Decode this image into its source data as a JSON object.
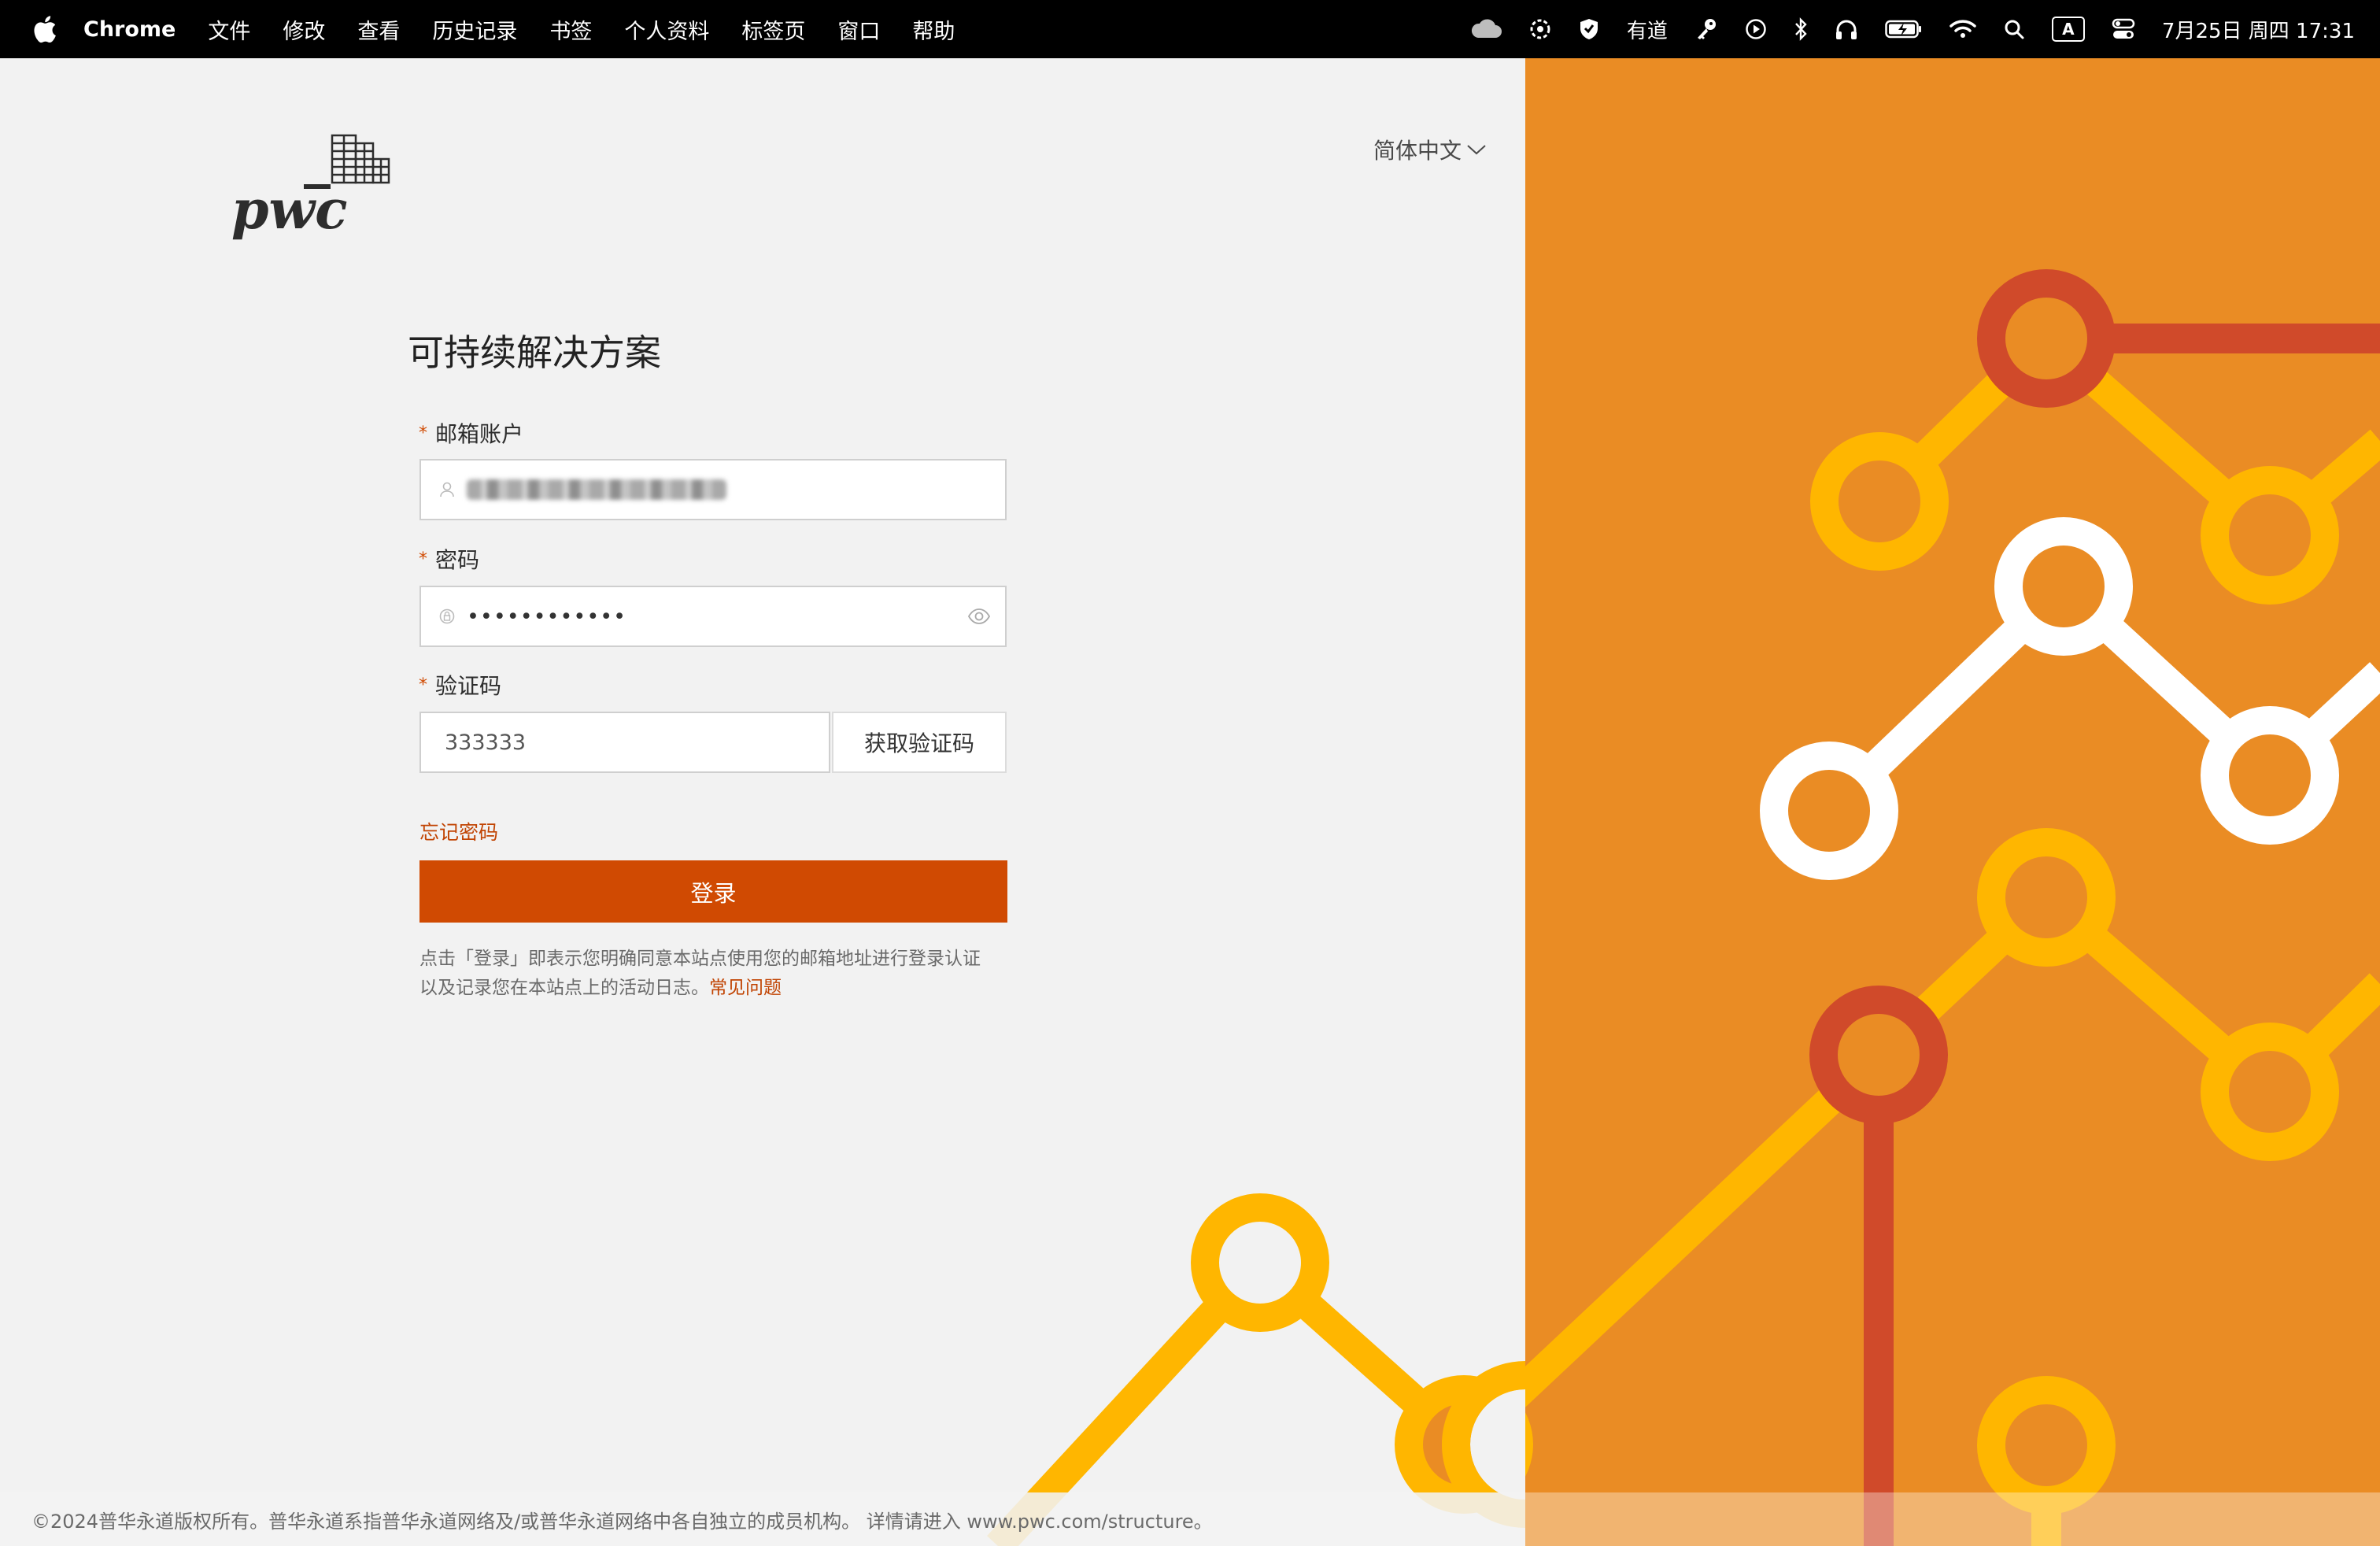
{
  "menubar": {
    "app_name": "Chrome",
    "items": [
      "文件",
      "修改",
      "查看",
      "历史记录",
      "书签",
      "个人资料",
      "标签页",
      "窗口",
      "帮助"
    ],
    "status": {
      "youdao": "有道",
      "input_method": "A",
      "datetime": "7月25日 周四 17:31"
    }
  },
  "page": {
    "language": "简体中文",
    "title": "可持续解决方案",
    "email": {
      "label": "邮箱账户",
      "required_mark": "*"
    },
    "password": {
      "label": "密码",
      "required_mark": "*",
      "masked_value": "••••••••••••"
    },
    "code": {
      "label": "验证码",
      "required_mark": "*",
      "value": "333333",
      "get_code": "获取验证码"
    },
    "forgot": "忘记密码",
    "login": "登录",
    "notice_line1": "点击「登录」即表示您明确同意本站点使用您的邮箱地址进行登录认证",
    "notice_line2": "以及记录您在本站点上的活动日志。",
    "faq": "常见问题",
    "footer": "©2024普华永道版权所有。普华永道系指普华永道网络及/或普华永道网络中各自独立的成员机构。 详情请进入 www.pwc.com/structure。"
  },
  "colors": {
    "brand": "#d04a02",
    "orange_bg": "#ea8c24",
    "yellow": "#ffb600",
    "red": "#d04a2a",
    "white": "#ffffff"
  }
}
